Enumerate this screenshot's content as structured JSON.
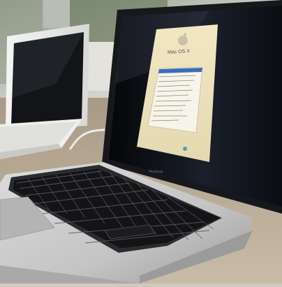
{
  "scene": {
    "description_items": [
      "background-window",
      "white-macbook-left",
      "aluminum-macbook-pro",
      "screen-installer-window",
      "keyboard",
      "trackpad"
    ]
  },
  "installer": {
    "title": "Mac OS X",
    "icon": "apple-logo-icon"
  },
  "laptop": {
    "brand": "MacBook"
  },
  "colors": {
    "screen_glass": "#0b0d12",
    "installer_panel": "#ebe2bf",
    "aluminum": "#c8c8c8",
    "keys": "#1a1a1c",
    "table_wood": "#b9ad9b",
    "list_highlight": "#3b6fb6"
  }
}
